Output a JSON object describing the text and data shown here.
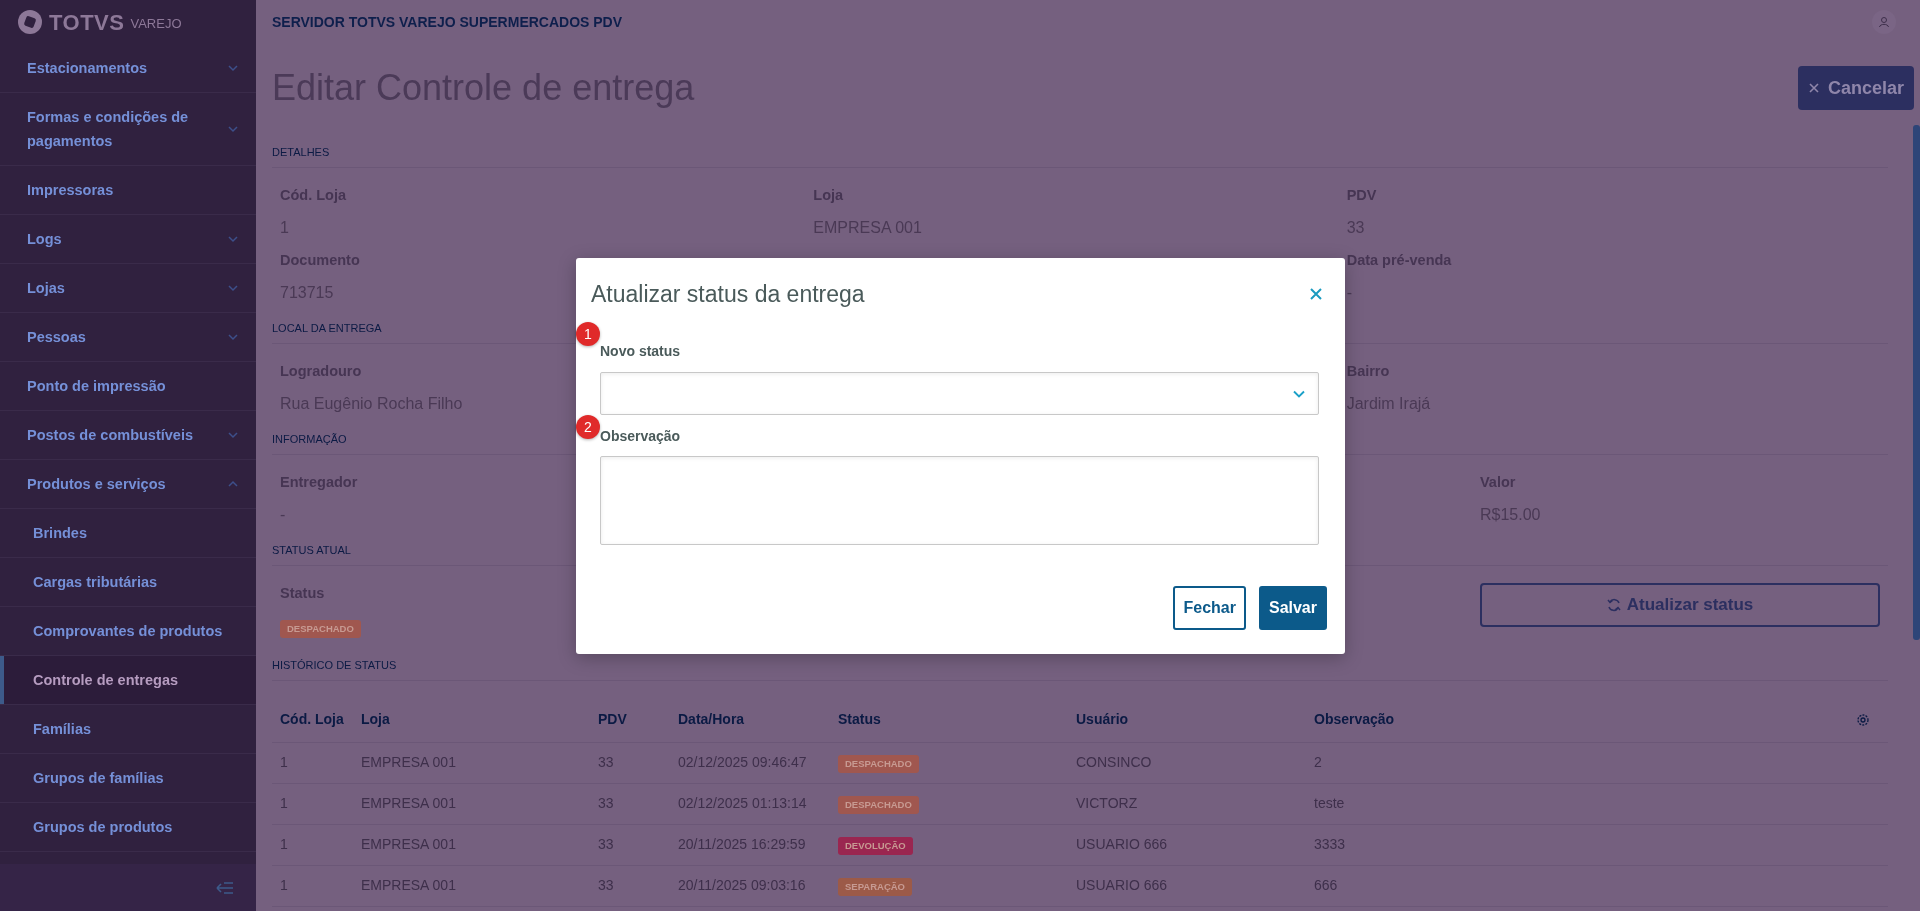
{
  "sidebar": {
    "logo": {
      "brand": "TOTVS",
      "product": "VAREJO"
    },
    "items": [
      {
        "label": "Estacionamentos",
        "kind": "group",
        "expanded": false,
        "selected": false
      },
      {
        "label": "Formas e condições de pagamentos",
        "kind": "group",
        "expanded": false,
        "selected": false
      },
      {
        "label": "Impressoras",
        "kind": "link",
        "selected": false
      },
      {
        "label": "Logs",
        "kind": "group",
        "expanded": false,
        "selected": false
      },
      {
        "label": "Lojas",
        "kind": "group",
        "expanded": false,
        "selected": false
      },
      {
        "label": "Pessoas",
        "kind": "group",
        "expanded": false,
        "selected": false
      },
      {
        "label": "Ponto de impressão",
        "kind": "link",
        "selected": false
      },
      {
        "label": "Postos de combustíveis",
        "kind": "group",
        "expanded": false,
        "selected": false
      },
      {
        "label": "Produtos e serviços",
        "kind": "group",
        "expanded": true,
        "selected": false,
        "children": [
          {
            "label": "Brindes",
            "kind": "link",
            "selected": false
          },
          {
            "label": "Cargas tributárias",
            "kind": "link",
            "selected": false
          },
          {
            "label": "Comprovantes de produtos",
            "kind": "link",
            "selected": false
          },
          {
            "label": "Controle de entregas",
            "kind": "link",
            "selected": true
          },
          {
            "label": "Famílias",
            "kind": "link",
            "selected": false
          },
          {
            "label": "Grupos de famílias",
            "kind": "link",
            "selected": false
          },
          {
            "label": "Grupos de produtos",
            "kind": "link",
            "selected": false
          }
        ]
      }
    ]
  },
  "header": {
    "server": "SERVIDOR TOTVS VAREJO SUPERMERCADOS PDV"
  },
  "page": {
    "title": "Editar Controle de entrega",
    "cancel_button": "Cancelar"
  },
  "sections": [
    {
      "heading": "DETALHES",
      "fields": [
        {
          "label": "Cód. Loja",
          "value": "1"
        },
        {
          "label": "Loja",
          "value": "EMPRESA 001"
        },
        {
          "label": "PDV",
          "value": "33"
        },
        {
          "label": "Documento",
          "value": "713715"
        },
        {
          "label": "Data pré-venda",
          "value": "-"
        }
      ]
    },
    {
      "heading": "LOCAL DA ENTREGA",
      "fields": [
        {
          "label": "Logradouro",
          "value": "Rua Eugênio Rocha Filho"
        },
        {
          "label": "Bairro",
          "value": "Jardim Irajá"
        }
      ]
    },
    {
      "heading": "INFORMAÇÃO",
      "fields": [
        {
          "label": "Entregador",
          "value": "-"
        },
        {
          "label": "Valor",
          "value": "R$15.00"
        }
      ]
    },
    {
      "heading": "STATUS ATUAL",
      "fields": [
        {
          "label": "Status",
          "value": "DESPACHADO",
          "kind": "badge",
          "color": "#a0574f"
        }
      ],
      "action_button": "Atualizar status"
    }
  ],
  "history": {
    "heading": "HISTÓRICO DE STATUS",
    "columns": [
      "Cód. Loja",
      "Loja",
      "PDV",
      "Data/Hora",
      "Status",
      "Usuário",
      "Observação"
    ],
    "rows": [
      {
        "cod_loja": "1",
        "loja": "EMPRESA 001",
        "pdv": "33",
        "data_hora": "02/12/2025 09:46:47",
        "status": "DESPACHADO",
        "color": "#a0574f",
        "usuario": "CONSINCO",
        "observacao": "2"
      },
      {
        "cod_loja": "1",
        "loja": "EMPRESA 001",
        "pdv": "33",
        "data_hora": "02/12/2025 01:13:14",
        "status": "DESPACHADO",
        "color": "#a0574f",
        "usuario": "VICTORZ",
        "observacao": "teste"
      },
      {
        "cod_loja": "1",
        "loja": "EMPRESA 001",
        "pdv": "33",
        "data_hora": "20/11/2025 16:29:59",
        "status": "DEVOLUÇÃO",
        "color": "#9a2650",
        "usuario": "USUARIO 666",
        "observacao": "3333"
      },
      {
        "cod_loja": "1",
        "loja": "EMPRESA 001",
        "pdv": "33",
        "data_hora": "20/11/2025 09:03:16",
        "status": "SEPARAÇÃO",
        "color": "#9c5a48",
        "usuario": "USUARIO 666",
        "observacao": "666"
      }
    ]
  },
  "dialog": {
    "title": "Atualizar status da entrega",
    "fields": [
      {
        "kind": "select",
        "label": "Novo status",
        "marker": "1"
      },
      {
        "kind": "textarea",
        "label": "Observação",
        "marker": "2"
      }
    ],
    "buttons": [
      {
        "label": "Fechar",
        "kind": "secondary"
      },
      {
        "label": "Salvar",
        "kind": "primary"
      }
    ]
  }
}
